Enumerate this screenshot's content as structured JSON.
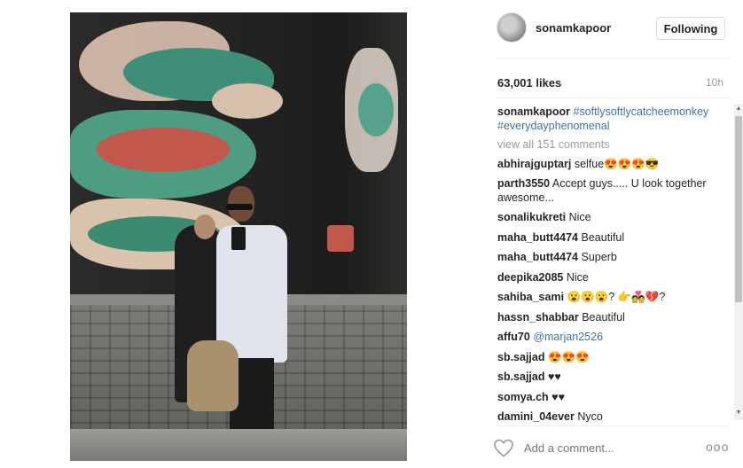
{
  "post": {
    "username": "sonamkapoor",
    "follow_label": "Following",
    "likes": "63,001 likes",
    "time": "10h",
    "caption_user": "sonamkapoor",
    "caption_tags": "#softlysoftlycatcheemonkey #everydayphenomenal",
    "view_all": "view all 151 comments",
    "comments": [
      {
        "user": "abhirajguptarj",
        "text": "selfue😍😍😍😎"
      },
      {
        "user": "parth3550",
        "text": "Accept guys..... U look together awesome..."
      },
      {
        "user": "sonalikukreti",
        "text": "Nice"
      },
      {
        "user": "maha_butt4474",
        "text": "Beautiful"
      },
      {
        "user": "maha_butt4474",
        "text": "Superb"
      },
      {
        "user": "deepika2085",
        "text": "Nice"
      },
      {
        "user": "sahiba_sami",
        "text": "😮😮😮? 👉💑💔?"
      },
      {
        "user": "hassn_shabbar",
        "text": "Beautiful"
      },
      {
        "user": "affu70",
        "text": "@marjan2526"
      },
      {
        "user": "sb.sajjad",
        "text": "😍😍😍"
      },
      {
        "user": "sb.sajjad",
        "text": "♥♥"
      },
      {
        "user": "somya.ch",
        "text": "♥♥"
      },
      {
        "user": "damini_04ever",
        "text": "Nyco"
      }
    ],
    "add_comment_placeholder": "Add a comment...",
    "more_dots": "ooo"
  },
  "icons": {
    "heart": "heart-outline-icon",
    "more": "more-options-icon",
    "scroll_up": "scroll-up-arrow-icon",
    "scroll_down": "scroll-down-arrow-icon"
  },
  "colors": {
    "link": "#3f729b",
    "muted": "#999999",
    "text": "#262626"
  }
}
